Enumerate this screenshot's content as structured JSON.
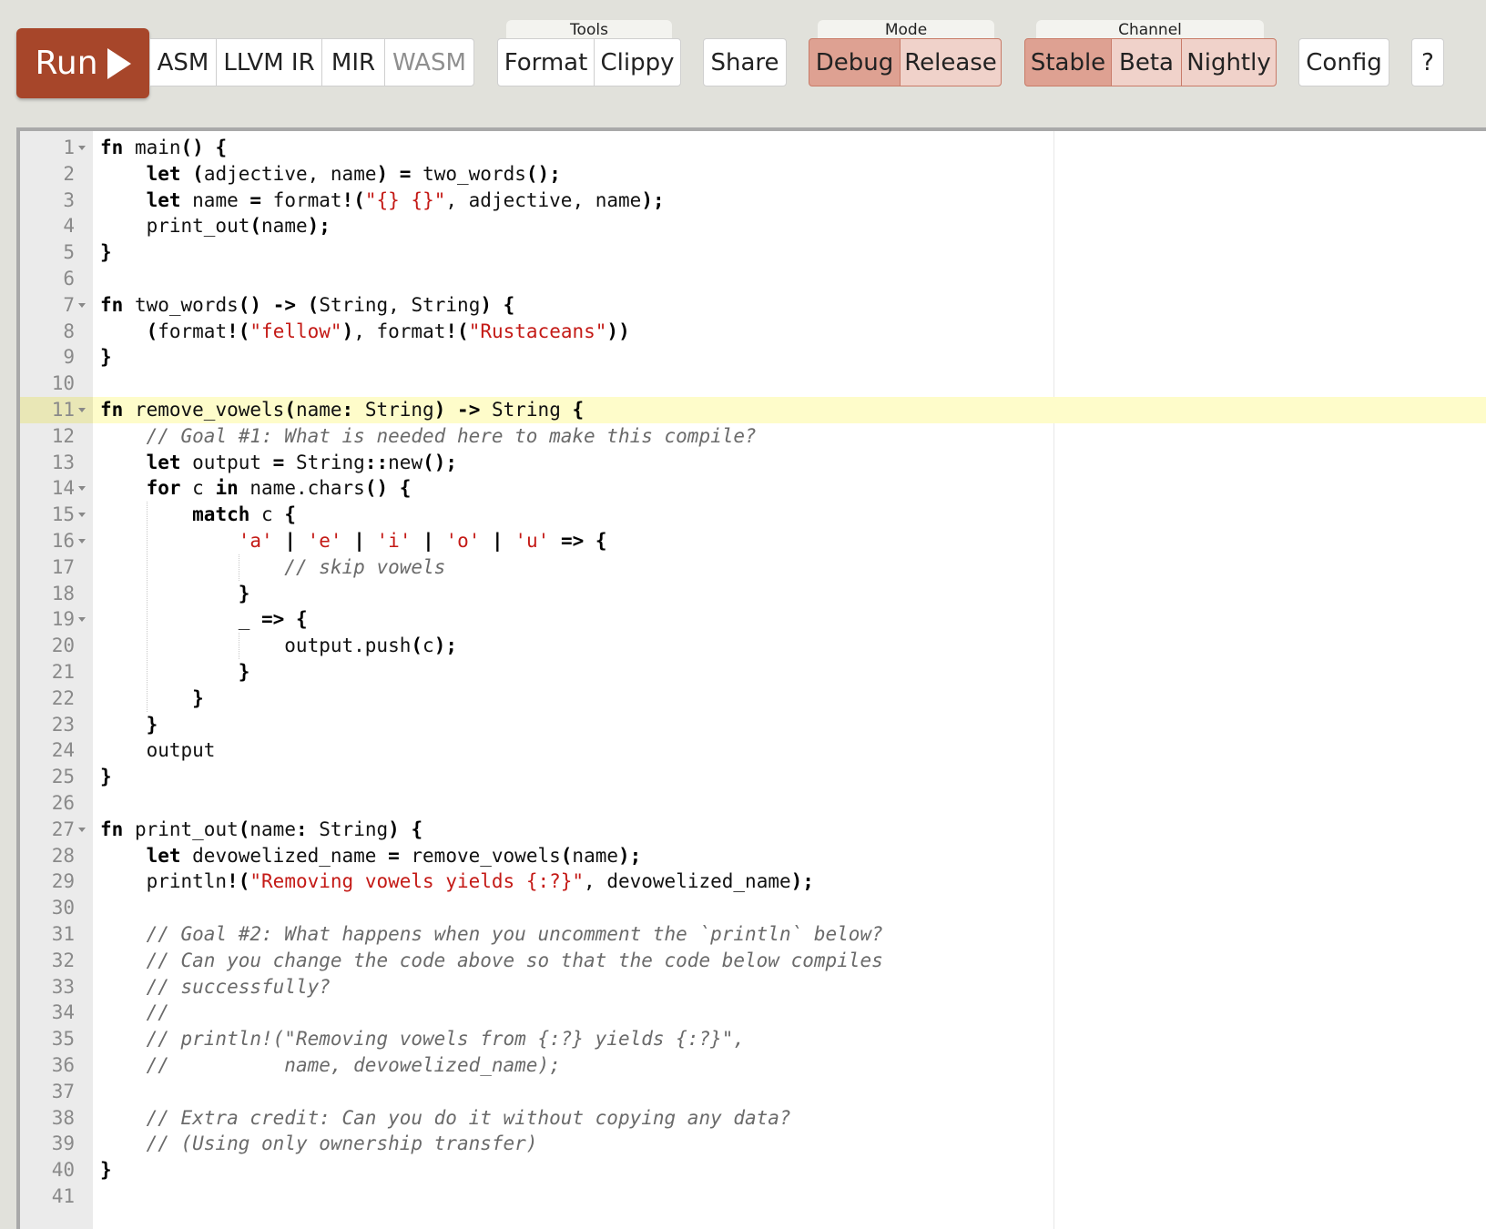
{
  "toolbar": {
    "run_label": "Run",
    "output_buttons": [
      "ASM",
      "LLVM IR",
      "MIR",
      "WASM"
    ],
    "tools_label": "Tools",
    "tools_buttons": [
      "Format",
      "Clippy"
    ],
    "share_label": "Share",
    "mode_label": "Mode",
    "mode_buttons": [
      "Debug",
      "Release"
    ],
    "mode_selected": "Debug",
    "channel_label": "Channel",
    "channel_buttons": [
      "Stable",
      "Beta",
      "Nightly"
    ],
    "channel_selected": "Stable",
    "config_label": "Config",
    "help_label": "?"
  },
  "colors": {
    "run_button": "#a7462a",
    "selected_option": "#dea192",
    "active_line": "#fefcca",
    "keyword": "#000000",
    "string": "#c41a16",
    "comment": "#6a6a6a"
  },
  "editor": {
    "active_line": 11,
    "fold_lines": [
      1,
      7,
      11,
      14,
      15,
      16,
      19,
      27
    ],
    "lines": [
      "fn main() {",
      "    let (adjective, name) = two_words();",
      "    let name = format!(\"{} {}\", adjective, name);",
      "    print_out(name);",
      "}",
      "",
      "fn two_words() -> (String, String) {",
      "    (format!(\"fellow\"), format!(\"Rustaceans\"))",
      "}",
      "",
      "fn remove_vowels(name: String) -> String {",
      "    // Goal #1: What is needed here to make this compile?",
      "    let output = String::new();",
      "    for c in name.chars() {",
      "        match c {",
      "            'a' | 'e' | 'i' | 'o' | 'u' => {",
      "                // skip vowels",
      "            }",
      "            _ => {",
      "                output.push(c);",
      "            }",
      "        }",
      "    }",
      "    output",
      "}",
      "",
      "fn print_out(name: String) {",
      "    let devowelized_name = remove_vowels(name);",
      "    println!(\"Removing vowels yields {:?}\", devowelized_name);",
      "",
      "    // Goal #2: What happens when you uncomment the `println` below?",
      "    // Can you change the code above so that the code below compiles",
      "    // successfully?",
      "    //",
      "    // println!(\"Removing vowels from {:?} yields {:?}\",",
      "    //          name, devowelized_name);",
      "",
      "    // Extra credit: Can you do it without copying any data?",
      "    // (Using only ownership transfer)",
      "}",
      ""
    ]
  }
}
